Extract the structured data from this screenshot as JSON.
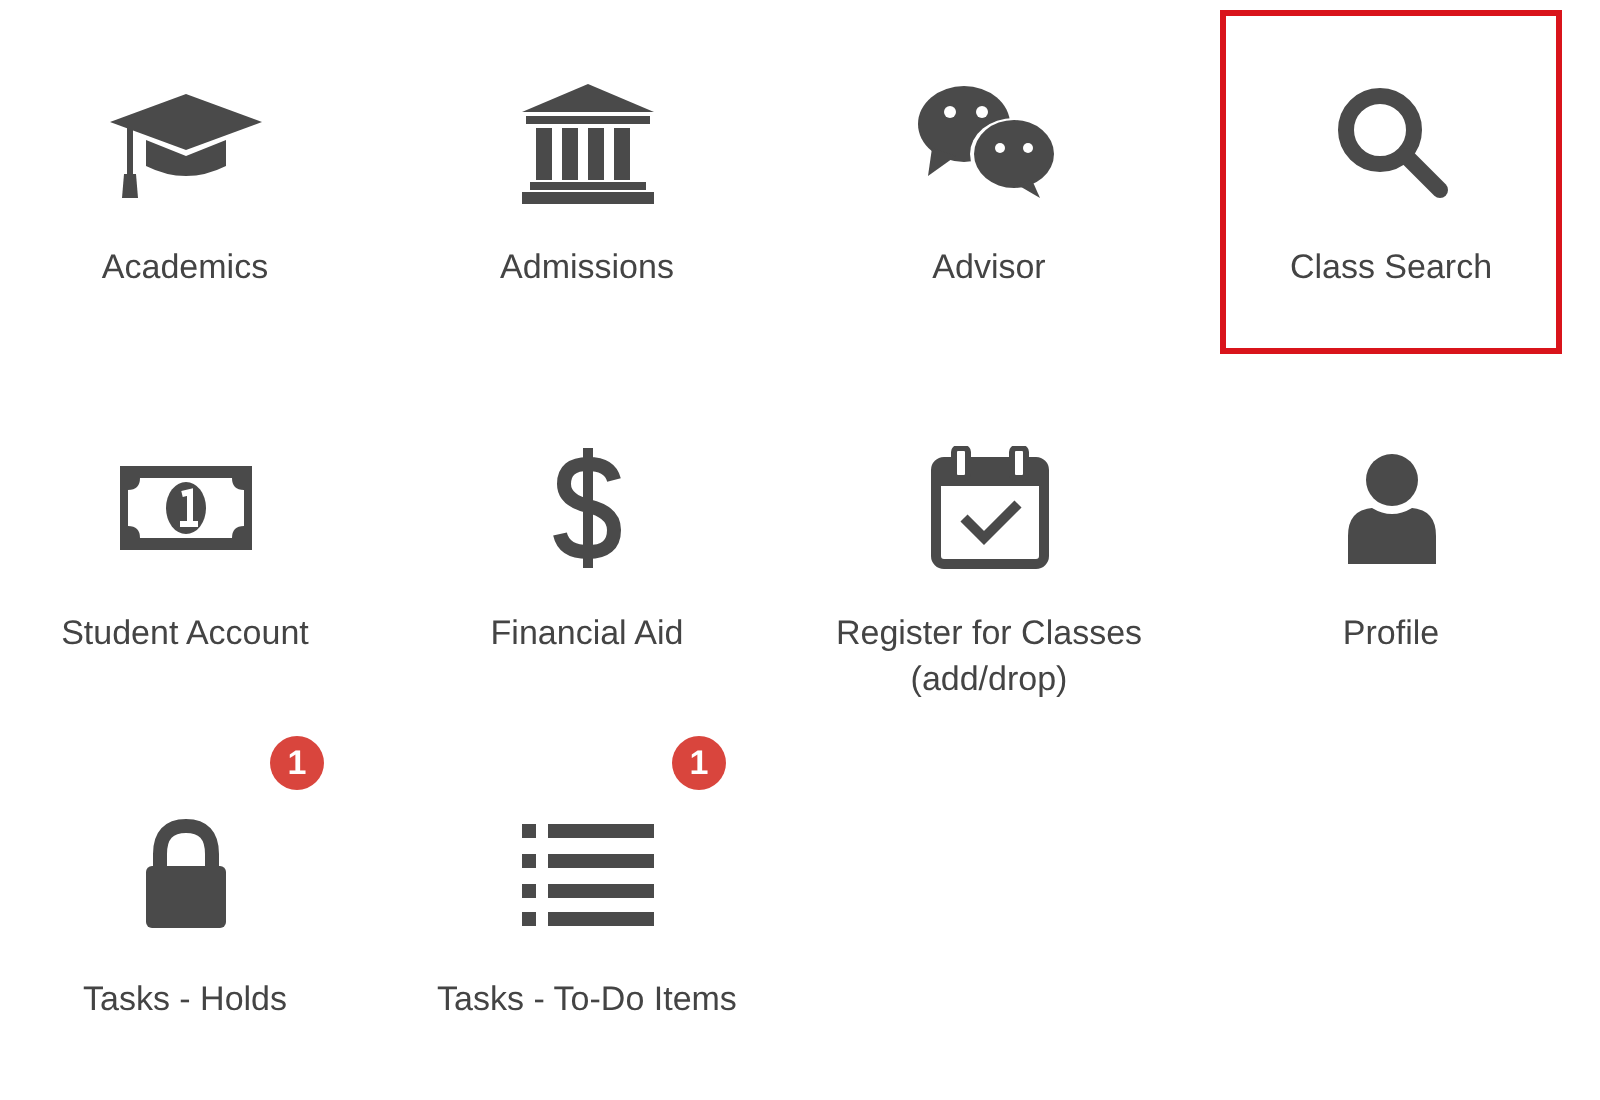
{
  "tiles": [
    {
      "label": "Academics",
      "selected": false
    },
    {
      "label": "Admissions",
      "selected": false
    },
    {
      "label": "Advisor",
      "selected": false
    },
    {
      "label": "Class Search",
      "selected": true
    },
    {
      "label": "Student Account",
      "selected": false
    },
    {
      "label": "Financial Aid",
      "selected": false
    },
    {
      "label": "Register for Classes (add/drop)",
      "selected": false
    },
    {
      "label": "Profile",
      "selected": false
    },
    {
      "label": "Tasks - Holds",
      "selected": false,
      "badge": "1"
    },
    {
      "label": "Tasks - To-Do Items",
      "selected": false,
      "badge": "1"
    }
  ]
}
